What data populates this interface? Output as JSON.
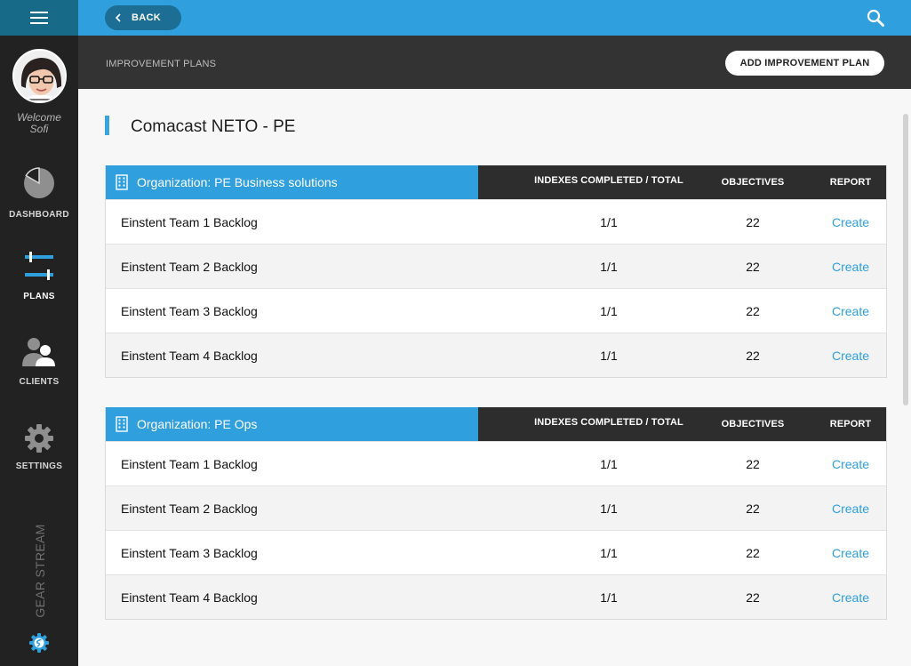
{
  "colors": {
    "accent": "#2f9fdd",
    "sidebar": "#222222",
    "subheader": "#333333",
    "link": "#2f9fdd"
  },
  "sidebar": {
    "menu_icon": "hamburger-icon",
    "welcome_line1": "Welcome",
    "welcome_line2": "Sofi",
    "items": [
      {
        "label": "DASHBOARD",
        "icon": "pie-chart-icon",
        "active": false
      },
      {
        "label": "PLANS",
        "icon": "sliders-icon",
        "active": true
      },
      {
        "label": "CLIENTS",
        "icon": "users-icon",
        "active": false
      },
      {
        "label": "SETTINGS",
        "icon": "gear-icon",
        "active": false
      }
    ],
    "brand": "GEAR STREAM",
    "brand_logo_icon": "gearstream-logo-icon"
  },
  "topbar": {
    "back_label": "BACK",
    "search_icon": "search-icon"
  },
  "subheader": {
    "title": "IMPROVEMENT PLANS",
    "add_button": "ADD IMPROVEMENT PLAN"
  },
  "main": {
    "page_title": "Comacast NETO - PE",
    "columns": {
      "indexes": "INDEXES COMPLETED / TOTAL",
      "objectives": "OBJECTIVES",
      "report": "REPORT"
    },
    "organizations": [
      {
        "name": "Organization: PE Business solutions",
        "rows": [
          {
            "name": "Einstent Team 1 Backlog",
            "indexes": "1/1",
            "objectives": "22",
            "report": "Create"
          },
          {
            "name": "Einstent Team 2 Backlog",
            "indexes": "1/1",
            "objectives": "22",
            "report": "Create"
          },
          {
            "name": "Einstent Team 3 Backlog",
            "indexes": "1/1",
            "objectives": "22",
            "report": "Create"
          },
          {
            "name": "Einstent Team 4 Backlog",
            "indexes": "1/1",
            "objectives": "22",
            "report": "Create"
          }
        ]
      },
      {
        "name": "Organization: PE Ops",
        "rows": [
          {
            "name": "Einstent Team 1 Backlog",
            "indexes": "1/1",
            "objectives": "22",
            "report": "Create"
          },
          {
            "name": "Einstent Team 2 Backlog",
            "indexes": "1/1",
            "objectives": "22",
            "report": "Create"
          },
          {
            "name": "Einstent Team 3 Backlog",
            "indexes": "1/1",
            "objectives": "22",
            "report": "Create"
          },
          {
            "name": "Einstent Team 4 Backlog",
            "indexes": "1/1",
            "objectives": "22",
            "report": "Create"
          }
        ]
      }
    ]
  }
}
